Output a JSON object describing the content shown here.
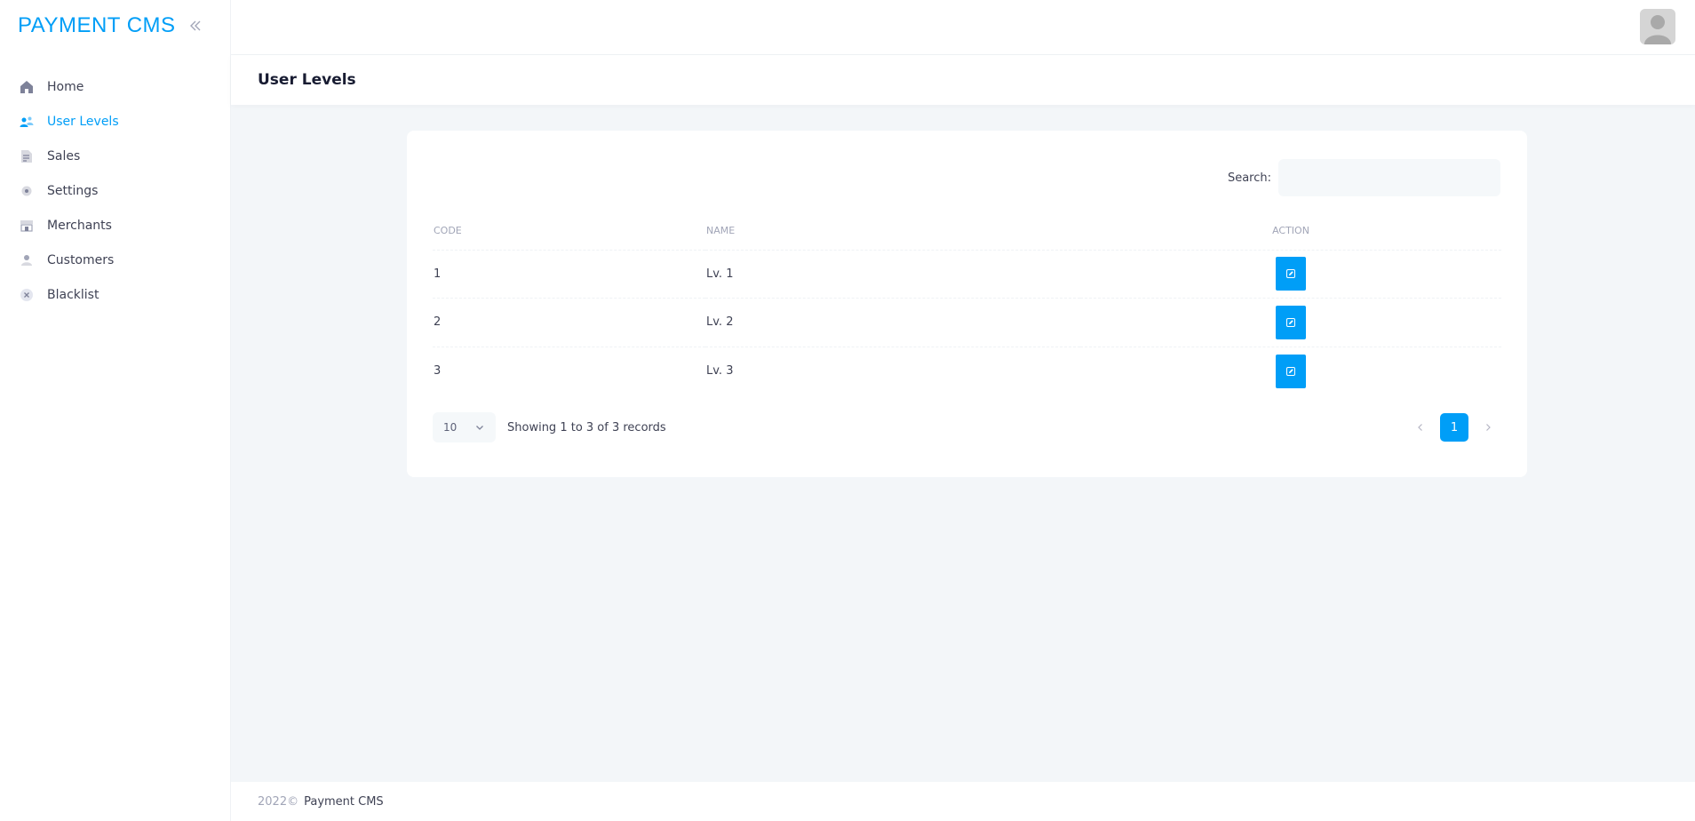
{
  "sidebar": {
    "brand": "PAYMENT CMS",
    "items": [
      {
        "label": "Home",
        "icon": "home-icon",
        "active": false
      },
      {
        "label": "User Levels",
        "icon": "users-icon",
        "active": true
      },
      {
        "label": "Sales",
        "icon": "document-icon",
        "active": false
      },
      {
        "label": "Settings",
        "icon": "gear-icon",
        "active": false
      },
      {
        "label": "Merchants",
        "icon": "store-icon",
        "active": false
      },
      {
        "label": "Customers",
        "icon": "user-icon",
        "active": false
      },
      {
        "label": "Blacklist",
        "icon": "close-circle-icon",
        "active": false
      }
    ]
  },
  "toolbar": {
    "title": "User Levels"
  },
  "table": {
    "search_label": "Search:",
    "search_value": "",
    "columns": {
      "code": "CODE",
      "name": "NAME",
      "action": "ACTION"
    },
    "rows": [
      {
        "code": "1",
        "name": "Lv. 1"
      },
      {
        "code": "2",
        "name": "Lv. 2"
      },
      {
        "code": "3",
        "name": "Lv. 3"
      }
    ],
    "page_length": "10",
    "info": "Showing 1 to 3 of 3 records",
    "current_page": "1"
  },
  "footer": {
    "year": "2022©",
    "link": "Payment CMS"
  },
  "colors": {
    "accent": "#009ef7",
    "text": "#3f4254",
    "muted": "#a1a5b7"
  }
}
